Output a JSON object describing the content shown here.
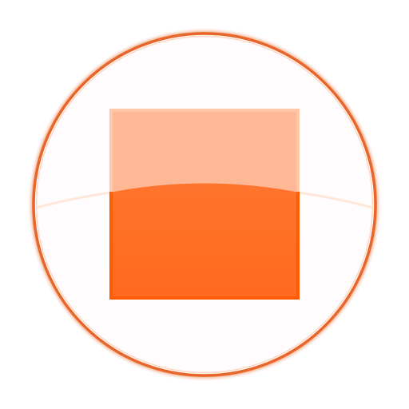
{
  "icon": {
    "name": "stop-icon",
    "kind": "media-stop-button",
    "colors": {
      "accent": "#ff6a1f",
      "accent_dark": "#ff5a00",
      "accent_light": "#ffb896",
      "ring": "#e8662a",
      "face": "#fffcfd"
    }
  }
}
